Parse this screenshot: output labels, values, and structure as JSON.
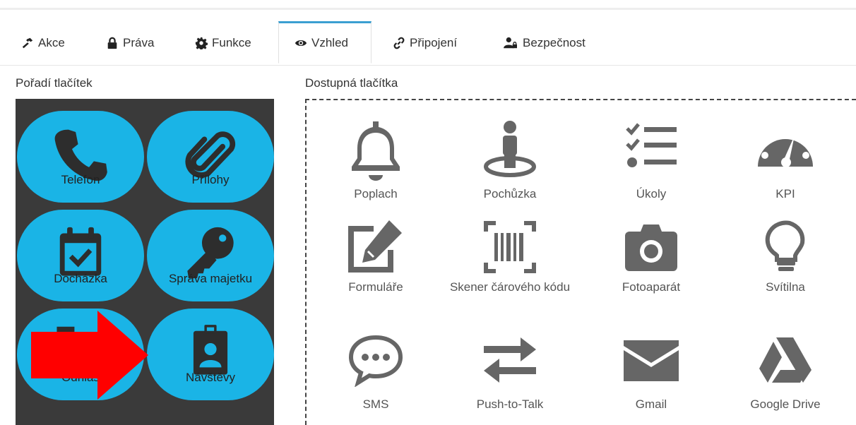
{
  "tabs": [
    {
      "label": "Akce",
      "icon": "hammer-icon"
    },
    {
      "label": "Práva",
      "icon": "lock-icon"
    },
    {
      "label": "Funkce",
      "icon": "gear-icon"
    },
    {
      "label": "Vzhled",
      "icon": "eye-icon",
      "active": true
    },
    {
      "label": "Připojení",
      "icon": "link-icon"
    },
    {
      "label": "Bezpečnost",
      "icon": "user-lock-icon"
    }
  ],
  "left_section": {
    "title": "Pořadí tlačítek",
    "buttons": [
      {
        "label": "Telefon",
        "icon": "phone-icon"
      },
      {
        "label": "Přílohy",
        "icon": "paperclip-icon"
      },
      {
        "label": "Docházka",
        "icon": "calendar-check-icon"
      },
      {
        "label": "Správa majetku",
        "icon": "key-icon"
      },
      {
        "label": "Odhlas",
        "icon": "signout-icon"
      },
      {
        "label": "Návštěvy",
        "icon": "id-badge-icon"
      }
    ]
  },
  "right_section": {
    "title": "Dostupná tlačítka",
    "buttons": [
      {
        "label": "Poplach",
        "icon": "bell-icon"
      },
      {
        "label": "Pochůzka",
        "icon": "street-view-icon"
      },
      {
        "label": "Úkoly",
        "icon": "tasks-icon"
      },
      {
        "label": "KPI",
        "icon": "dashboard-icon"
      },
      {
        "label": "Formuláře",
        "icon": "edit-icon"
      },
      {
        "label": "Skener čárového kódu",
        "icon": "barcode-icon"
      },
      {
        "label": "Fotoaparát",
        "icon": "camera-icon"
      },
      {
        "label": "Svítilna",
        "icon": "lightbulb-icon"
      },
      {
        "label": "SMS",
        "icon": "chat-icon"
      },
      {
        "label": "Push-to-Talk",
        "icon": "exchange-icon"
      },
      {
        "label": "Gmail",
        "icon": "envelope-icon"
      },
      {
        "label": "Google Drive",
        "icon": "google-drive-icon"
      }
    ]
  },
  "colors": {
    "accent": "#1ab4e6",
    "panel_bg": "#3a3a3a",
    "tab_active_border": "#3b9fd1",
    "arrow": "#ff0000",
    "icon_gray": "#666666"
  }
}
